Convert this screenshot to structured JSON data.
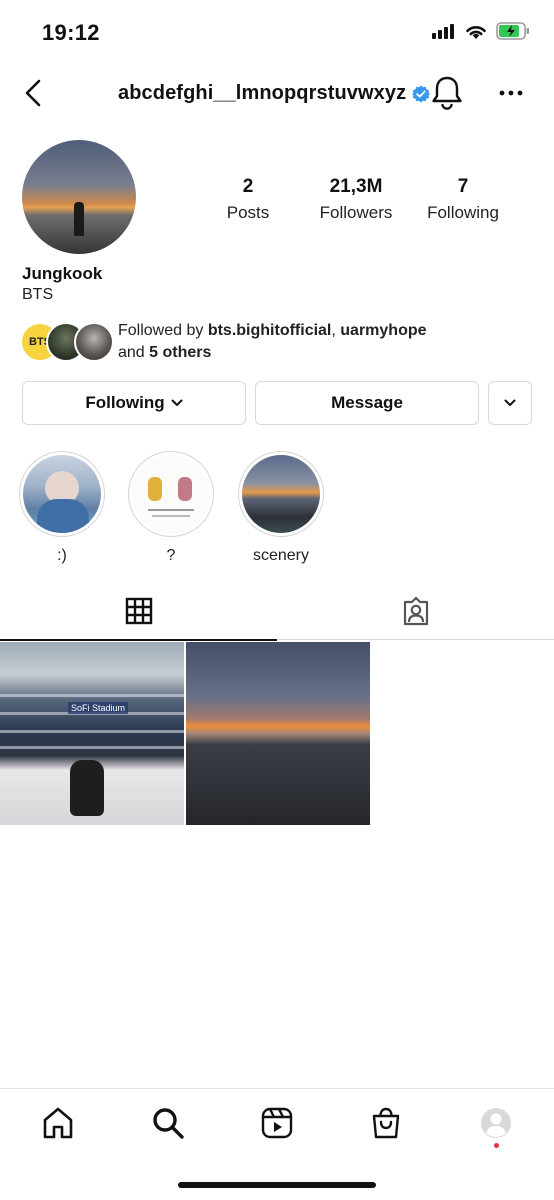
{
  "status": {
    "time": "19:12"
  },
  "header": {
    "username": "abcdefghi__lmnopqrstuvwxyz",
    "verified": true
  },
  "profile": {
    "display_name": "Jungkook",
    "bio": "BTS",
    "stats": [
      {
        "value": "2",
        "label": "Posts"
      },
      {
        "value": "21,3M",
        "label": "Followers"
      },
      {
        "value": "7",
        "label": "Following"
      }
    ],
    "followed_by": {
      "prefix": "Followed by ",
      "user1": "bts.bighitofficial",
      "sep": ", ",
      "user2": "uarmyhope",
      "and": "and ",
      "others": "5 others",
      "badge_text": "BTS"
    }
  },
  "actions": {
    "following": "Following",
    "message": "Message"
  },
  "highlights": [
    {
      "label": ":)"
    },
    {
      "label": "?"
    },
    {
      "label": "scenery"
    }
  ],
  "posts": {
    "post1_sign": "SoFi Stadium"
  },
  "colors": {
    "verified": "#3897f0",
    "notification_dot": "#e3334a"
  }
}
